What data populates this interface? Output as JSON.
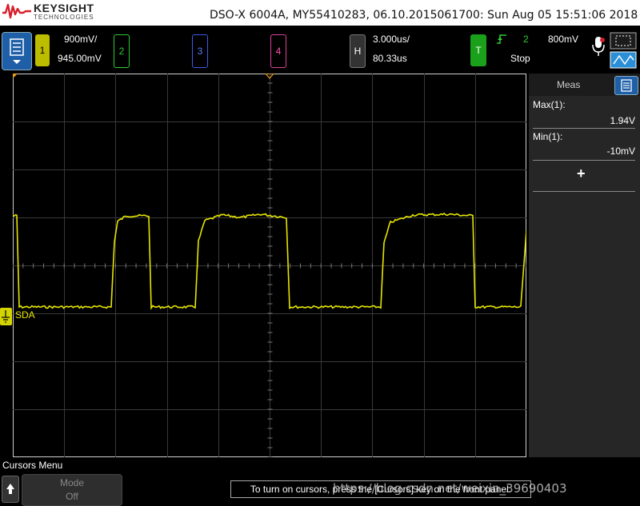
{
  "header": {
    "brand": "KEYSIGHT",
    "brand_sub": "TECHNOLOGIES",
    "model_info": "DSO-X 6004A, MY55410283, 06.10.2015061700: Sun Aug 05 15:51:06 2018"
  },
  "channels": {
    "ch1": {
      "label": "1",
      "scale": "900mV/",
      "offset": "945.00mV",
      "color": "#d4d400"
    },
    "ch2": {
      "label": "2",
      "color": "#2ecc2e"
    },
    "ch3": {
      "label": "3",
      "color": "#3b5be8"
    },
    "ch4": {
      "label": "4",
      "color": "#e0409a"
    }
  },
  "horizontal": {
    "label": "H",
    "time_scale": "3.000us/",
    "delay": "80.33us"
  },
  "trigger": {
    "label": "T",
    "source": "2",
    "level": "800mV",
    "status": "Stop"
  },
  "waveform": {
    "label": "SDA",
    "color": "#e6e600"
  },
  "meas": {
    "title": "Meas",
    "max_label": "Max(1):",
    "max_value": "1.94V",
    "min_label": "Min(1):",
    "min_value": "-10mV",
    "add_symbol": "+"
  },
  "menu": {
    "title": "Cursors Menu",
    "softkey_title": "Mode",
    "softkey_value": "Off",
    "hint": "To turn on cursors, press the [Cursors] key on the front panel."
  },
  "watermark": "https://blog.csdn.net/weixin_39690403"
}
